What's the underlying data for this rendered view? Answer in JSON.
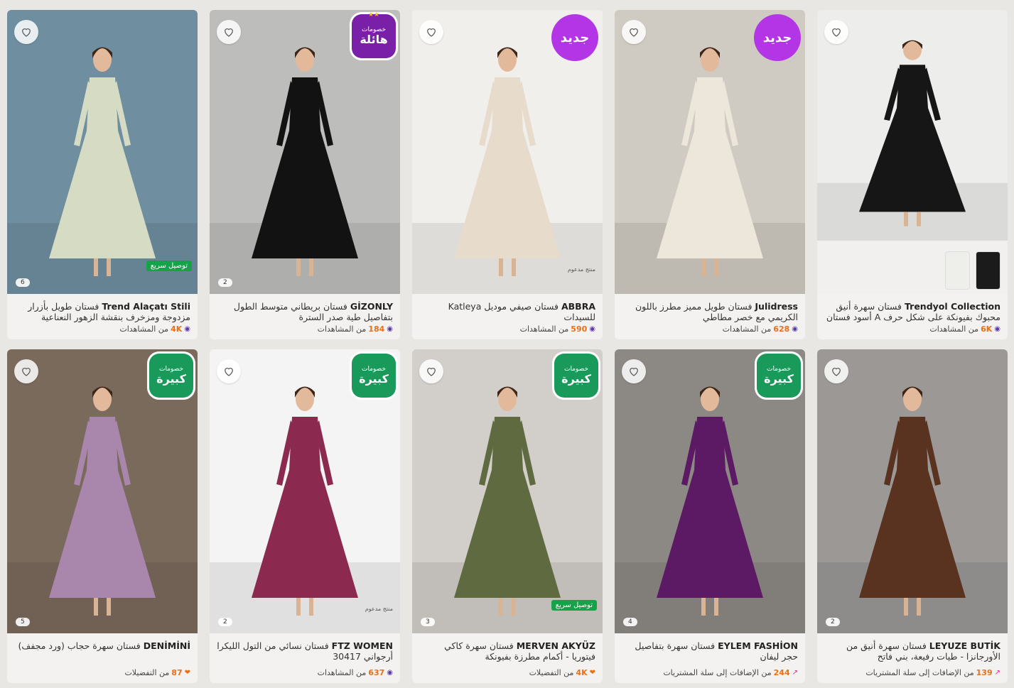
{
  "cards": [
    {
      "brand": "Trendyol Collection",
      "title": "فستان سهرة أنيق محبوك بفيونكة على شكل حرف A أسود فستان سهرة...",
      "stat_num": "6K",
      "stat_text": "من المشاهدات",
      "stat_icon": "eyes-icon",
      "badge": null,
      "photo_count": null,
      "bg": "#ededeb",
      "dress": "#161616"
    },
    {
      "brand": "Julidress",
      "title": "فستان طويل مميز مطرز باللون الكريمي مع خصر مطاطي",
      "stat_num": "628",
      "stat_text": "من المشاهدات",
      "stat_icon": "eyes-icon",
      "badge": "جديد",
      "photo_count": null,
      "bg": "#cfcac2",
      "dress": "#ece7da"
    },
    {
      "brand": "ABBRA",
      "title": "فستان صيفي موديل Katleya للسيدات",
      "stat_num": "590",
      "stat_text": "من المشاهدات",
      "stat_icon": "eyes-icon",
      "badge": "جديد",
      "photo_count": null,
      "promoted": "منتج مدعوم",
      "bg": "#f1efec",
      "dress": "#e7dccb"
    },
    {
      "brand": "GİZONLY",
      "title": "فستان بريطاني متوسط الطول بتفاصيل طية صدر السترة",
      "stat_num": "184",
      "stat_text": "من المشاهدات",
      "stat_icon": "eyes-icon",
      "discount": {
        "l1": "خصومات",
        "l2": "هائلة",
        "stars": "★★"
      },
      "photo_count": "2",
      "bg": "#bdbdbb",
      "dress": "#121212"
    },
    {
      "brand": "Trend Alaçatı Stili",
      "title": "فستان طويل بأزرار مزدوجة ومزخرف بنقشة الزهور النعناعية للسيدات -ALC...",
      "stat_num": "4K",
      "stat_text": "من المشاهدات",
      "stat_icon": "eyes-icon",
      "fast": "توصيل سريع",
      "photo_count": "6",
      "bg": "#6f8fa0",
      "dress": "#d6dcc3"
    },
    {
      "brand": "LEYUZE BUTİK",
      "title": "فستان سهرة أنيق من الأورجانزا - طيات رفيعة، بني فاتح",
      "stat_num": "139",
      "stat_text": "من الإضافات إلى سلة المشتريات",
      "stat_icon": "cart-icon",
      "photo_count": "2",
      "bg": "#9b9896",
      "dress": "#5a3220"
    },
    {
      "brand": "EYLEM FASHİON",
      "title": "فستان سهرة بتفاصيل حجر ليفان",
      "stat_num": "244",
      "stat_text": "من الإضافات إلى سلة المشتريات",
      "stat_icon": "cart-icon",
      "discount": {
        "l1": "خصومات",
        "l2": "كبيرة",
        "stars": ""
      },
      "photo_count": "4",
      "bg": "#8c8884",
      "dress": "#5c1a64"
    },
    {
      "brand": "MERVEN AKYÜZ",
      "title": "فستان سهرة كاكي فيتوريا - أكمام مطرزة بفيونكة",
      "stat_num": "4K",
      "stat_text": "من التفضيلات",
      "stat_icon": "heart-icon",
      "discount": {
        "l1": "خصومات",
        "l2": "كبيرة",
        "stars": ""
      },
      "fast": "توصيل سريع",
      "photo_count": "3",
      "bg": "#d2cfca",
      "dress": "#5f6a40"
    },
    {
      "brand": "FTZ WOMEN",
      "title": "فستان نسائي من التول الليكرا أرجواني 30417",
      "stat_num": "637",
      "stat_text": "من المشاهدات",
      "stat_icon": "eyes-icon",
      "discount": {
        "l1": "خصومات",
        "l2": "كبيرة",
        "stars": ""
      },
      "promoted": "منتج مدعوم",
      "photo_count": "2",
      "bg": "#f4f4f4",
      "dress": "#8b2a4e"
    },
    {
      "brand": "DENİMİNİ",
      "title": "فستان سهرة حجاب (ورد مجفف)",
      "stat_num": "87",
      "stat_text": "من التفضيلات",
      "stat_icon": "heart-icon",
      "discount": {
        "l1": "خصومات",
        "l2": "كبيرة",
        "stars": ""
      },
      "photo_count": "5",
      "bg": "#7a6a5c",
      "dress": "#a987ad"
    }
  ]
}
